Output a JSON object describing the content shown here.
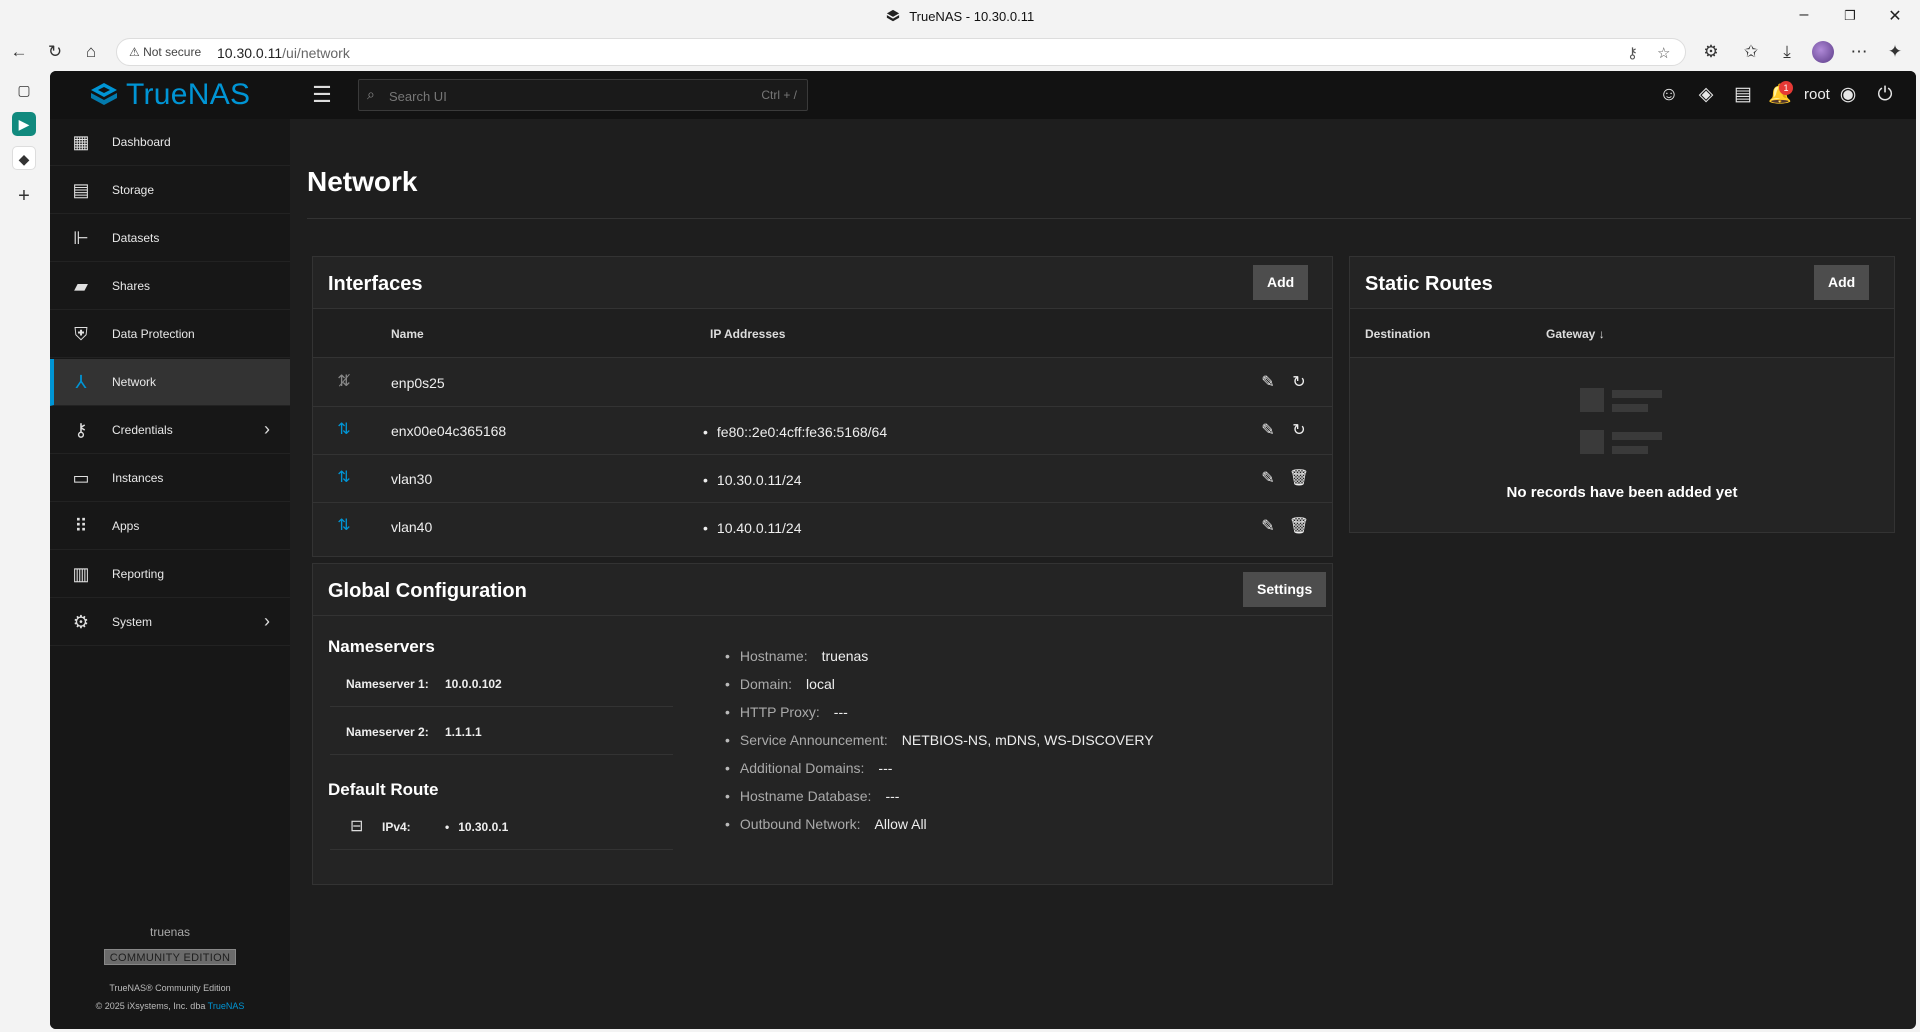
{
  "browser": {
    "window_title": "TrueNAS - 10.30.0.11",
    "security_label": "Not secure",
    "url_host": "10.30.0.11",
    "url_path": "/ui/network"
  },
  "app": {
    "brand": "TrueNAS",
    "search_placeholder": "Search UI",
    "search_shortcut": "Ctrl + /",
    "notification_count": "1",
    "user": "root"
  },
  "sidebar": {
    "items": [
      {
        "label": "Dashboard",
        "icon": "dashboard-icon"
      },
      {
        "label": "Storage",
        "icon": "storage-icon"
      },
      {
        "label": "Datasets",
        "icon": "datasets-icon"
      },
      {
        "label": "Shares",
        "icon": "shares-icon"
      },
      {
        "label": "Data Protection",
        "icon": "shield-icon"
      },
      {
        "label": "Network",
        "icon": "network-icon",
        "active": true
      },
      {
        "label": "Credentials",
        "icon": "key-icon"
      },
      {
        "label": "Instances",
        "icon": "laptop-icon"
      },
      {
        "label": "Apps",
        "icon": "apps-grid-icon"
      },
      {
        "label": "Reporting",
        "icon": "reporting-icon"
      },
      {
        "label": "System",
        "icon": "gear-icon"
      }
    ],
    "footer": {
      "hostname": "truenas",
      "edition_badge": "COMMUNITY EDITION",
      "product": "TrueNAS® Community Edition",
      "copyright": "© 2025 iXsystems, Inc. dba",
      "copyright_link": "TrueNAS"
    }
  },
  "page": {
    "title": "Network"
  },
  "interfaces": {
    "title": "Interfaces",
    "add_label": "Add",
    "columns": [
      "Name",
      "IP Addresses"
    ],
    "rows": [
      {
        "name": "enp0s25",
        "ip": "",
        "link": "down",
        "action2": "reset-icon"
      },
      {
        "name": "enx00e04c365168",
        "ip": "fe80::2e0:4cff:fe36:5168/64",
        "link": "up",
        "action2": "reset-icon"
      },
      {
        "name": "vlan30",
        "ip": "10.30.0.11/24",
        "link": "up",
        "action2": "delete-icon"
      },
      {
        "name": "vlan40",
        "ip": "10.40.0.11/24",
        "link": "up",
        "action2": "delete-icon"
      }
    ]
  },
  "static_routes": {
    "title": "Static Routes",
    "add_label": "Add",
    "columns": [
      "Destination",
      "Gateway"
    ],
    "sort_indicator": "↓",
    "empty_message": "No records have been added yet"
  },
  "global_config": {
    "title": "Global Configuration",
    "settings_label": "Settings",
    "nameservers_title": "Nameservers",
    "nameservers": [
      {
        "label": "Nameserver 1:",
        "value": "10.0.0.102"
      },
      {
        "label": "Nameserver 2:",
        "value": "1.1.1.1"
      }
    ],
    "default_route_title": "Default Route",
    "default_route": {
      "label": "IPv4:",
      "value": "10.30.0.1"
    },
    "details": [
      {
        "label": "Hostname:",
        "value": "truenas"
      },
      {
        "label": "Domain:",
        "value": "local"
      },
      {
        "label": "HTTP Proxy:",
        "value": "---"
      },
      {
        "label": "Service Announcement:",
        "value": "NETBIOS-NS, mDNS, WS-DISCOVERY"
      },
      {
        "label": "Additional Domains:",
        "value": "---"
      },
      {
        "label": "Hostname Database:",
        "value": "---"
      },
      {
        "label": "Outbound Network:",
        "value": "Allow All"
      }
    ]
  },
  "colors": {
    "accent": "#0095d5",
    "background": "#1e1e1e",
    "card": "#242424",
    "badge": "#e53935"
  }
}
